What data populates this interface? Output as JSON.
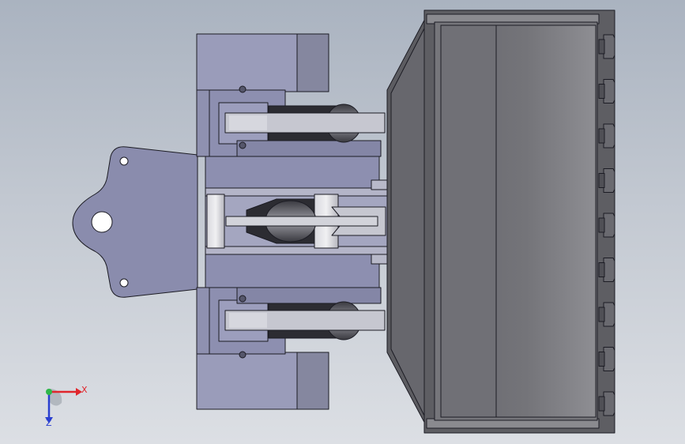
{
  "view": {
    "background_top": "#aab3c0",
    "background_bottom": "#dcdfe4",
    "part_colors": {
      "plate": "#9799b8",
      "plate_dark": "#7d7f9e",
      "bracket": "#8d8fb0",
      "metal_light": "#c8c9d2",
      "bucket_floor": "#6c6c74",
      "bucket_inner": "#848488",
      "bucket_rim": "#5e5e63",
      "edge": "#1c1c24"
    }
  },
  "triad": {
    "x_label": "X",
    "z_label": "Z",
    "x_color": "#e0262c",
    "y_color": "#2fb64a",
    "z_color": "#2a3fd0"
  }
}
